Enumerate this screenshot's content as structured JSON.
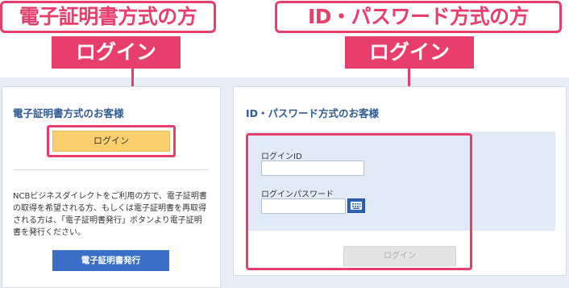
{
  "callouts": {
    "left": {
      "title": "電子証明書方式の方",
      "tag": "ログイン"
    },
    "right": {
      "title": "ID・パスワード方式の方",
      "tag": "ログイン"
    }
  },
  "cert_panel": {
    "title": "電子証明書方式のお客様",
    "login_button": "ログイン",
    "description": "NCBビジネスダイレクトをご利用の方で、電子証明書の取得を希望される方、もしくは電子証明書を再取得される方は、「電子証明書発行」ボタンより電子証明書を発行ください。",
    "issue_button": "電子証明書発行"
  },
  "password_panel": {
    "title": "ID・パスワード方式のお客様",
    "login_id_label": "ログインID",
    "login_id_value": "",
    "password_label": "ログインパスワード",
    "password_value": "",
    "keyboard_icon": "software-keyboard-icon",
    "login_button": "ログイン"
  },
  "colors": {
    "accent_red": "#e83e6c",
    "cert_login_button": "#fbcf6e",
    "issue_button": "#3b6fc5",
    "panel_title": "#2f5a92",
    "background": "#e6edf6"
  }
}
